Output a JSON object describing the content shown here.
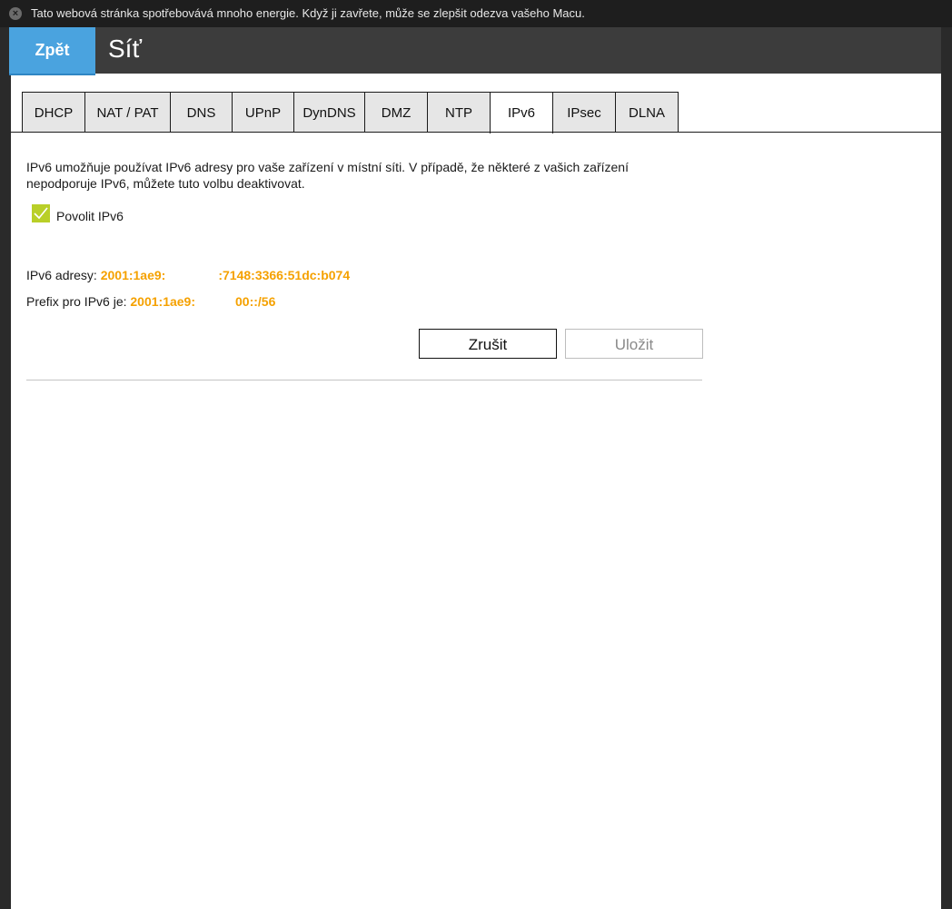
{
  "banner": {
    "message": "Tato webová stránka spotřebovává mnoho energie. Když ji zavřete, může se zlepšit odezva vašeho Macu.",
    "close_icon": "close-circle-icon"
  },
  "header": {
    "back_label": "Zpět",
    "title": "Síť"
  },
  "tabs": [
    {
      "label": "DHCP",
      "active": false
    },
    {
      "label": "NAT / PAT",
      "active": false
    },
    {
      "label": "DNS",
      "active": false
    },
    {
      "label": "UPnP",
      "active": false
    },
    {
      "label": "DynDNS",
      "active": false
    },
    {
      "label": "DMZ",
      "active": false
    },
    {
      "label": "NTP",
      "active": false
    },
    {
      "label": "IPv6",
      "active": true
    },
    {
      "label": "IPsec",
      "active": false
    },
    {
      "label": "DLNA",
      "active": false
    }
  ],
  "ipv6": {
    "description": "IPv6 umožňuje používat IPv6 adresy pro vaše zařízení v místní síti. V případě, že některé z vašich zařízení nepodporuje IPv6, můžete tuto volbu deaktivovat.",
    "enable_label": "Povolit IPv6",
    "enabled": true,
    "address_label": "IPv6 adresy:",
    "address_part1": "2001:1ae9:",
    "address_part2": ":7148:3366:51dc:b074",
    "prefix_label": "Prefix pro IPv6 je:",
    "prefix_part1": "2001:1ae9:",
    "prefix_part2": "00::/56"
  },
  "actions": {
    "cancel_label": "Zrušit",
    "save_label": "Uložit"
  },
  "colors": {
    "accent": "#4aa3df",
    "header_bg": "#3c3c3c",
    "checkbox": "#b9cf28",
    "value": "#f5a100"
  }
}
